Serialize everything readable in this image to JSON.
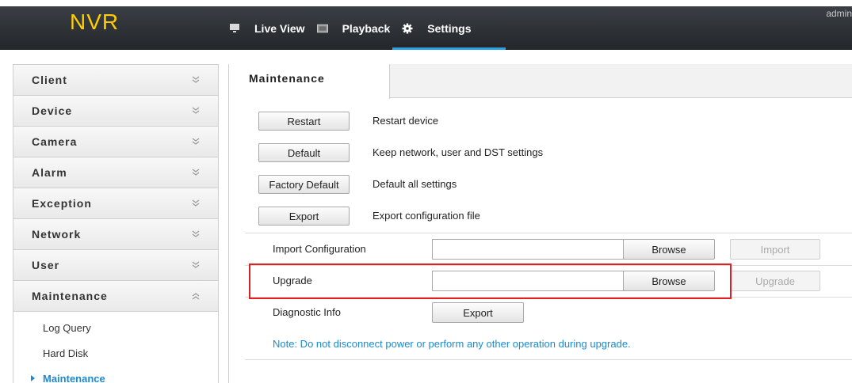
{
  "header": {
    "logo": "NVR",
    "user": "admin",
    "nav": [
      {
        "label": "Live View",
        "icon": "monitor-icon"
      },
      {
        "label": "Playback",
        "icon": "film-icon"
      },
      {
        "label": "Settings",
        "icon": "gear-icon"
      }
    ],
    "active_nav": "Settings"
  },
  "sidebar": {
    "items": [
      {
        "label": "Client"
      },
      {
        "label": "Device"
      },
      {
        "label": "Camera"
      },
      {
        "label": "Alarm"
      },
      {
        "label": "Exception"
      },
      {
        "label": "Network"
      },
      {
        "label": "User"
      },
      {
        "label": "Maintenance",
        "expanded": true
      }
    ],
    "subitems": [
      {
        "label": "Log Query"
      },
      {
        "label": "Hard Disk"
      },
      {
        "label": "Maintenance",
        "active": true
      }
    ]
  },
  "main": {
    "tab": "Maintenance",
    "actions": [
      {
        "button": "Restart",
        "description": "Restart device"
      },
      {
        "button": "Default",
        "description": "Keep network, user and DST settings"
      },
      {
        "button": "Factory Default",
        "description": "Default all settings"
      },
      {
        "button": "Export",
        "description": "Export configuration file"
      }
    ],
    "import_config": {
      "label": "Import Configuration",
      "value": "",
      "browse": "Browse",
      "action": "Import"
    },
    "upgrade": {
      "label": "Upgrade",
      "value": "",
      "browse": "Browse",
      "action": "Upgrade"
    },
    "diagnostic": {
      "label": "Diagnostic Info",
      "button": "Export"
    },
    "note": "Note: Do not disconnect power or perform any other operation during upgrade."
  },
  "colors": {
    "accent": "#2aa3e6",
    "logo": "#ffcc00",
    "highlight": "#e02020",
    "note": "#1b8ad3"
  }
}
